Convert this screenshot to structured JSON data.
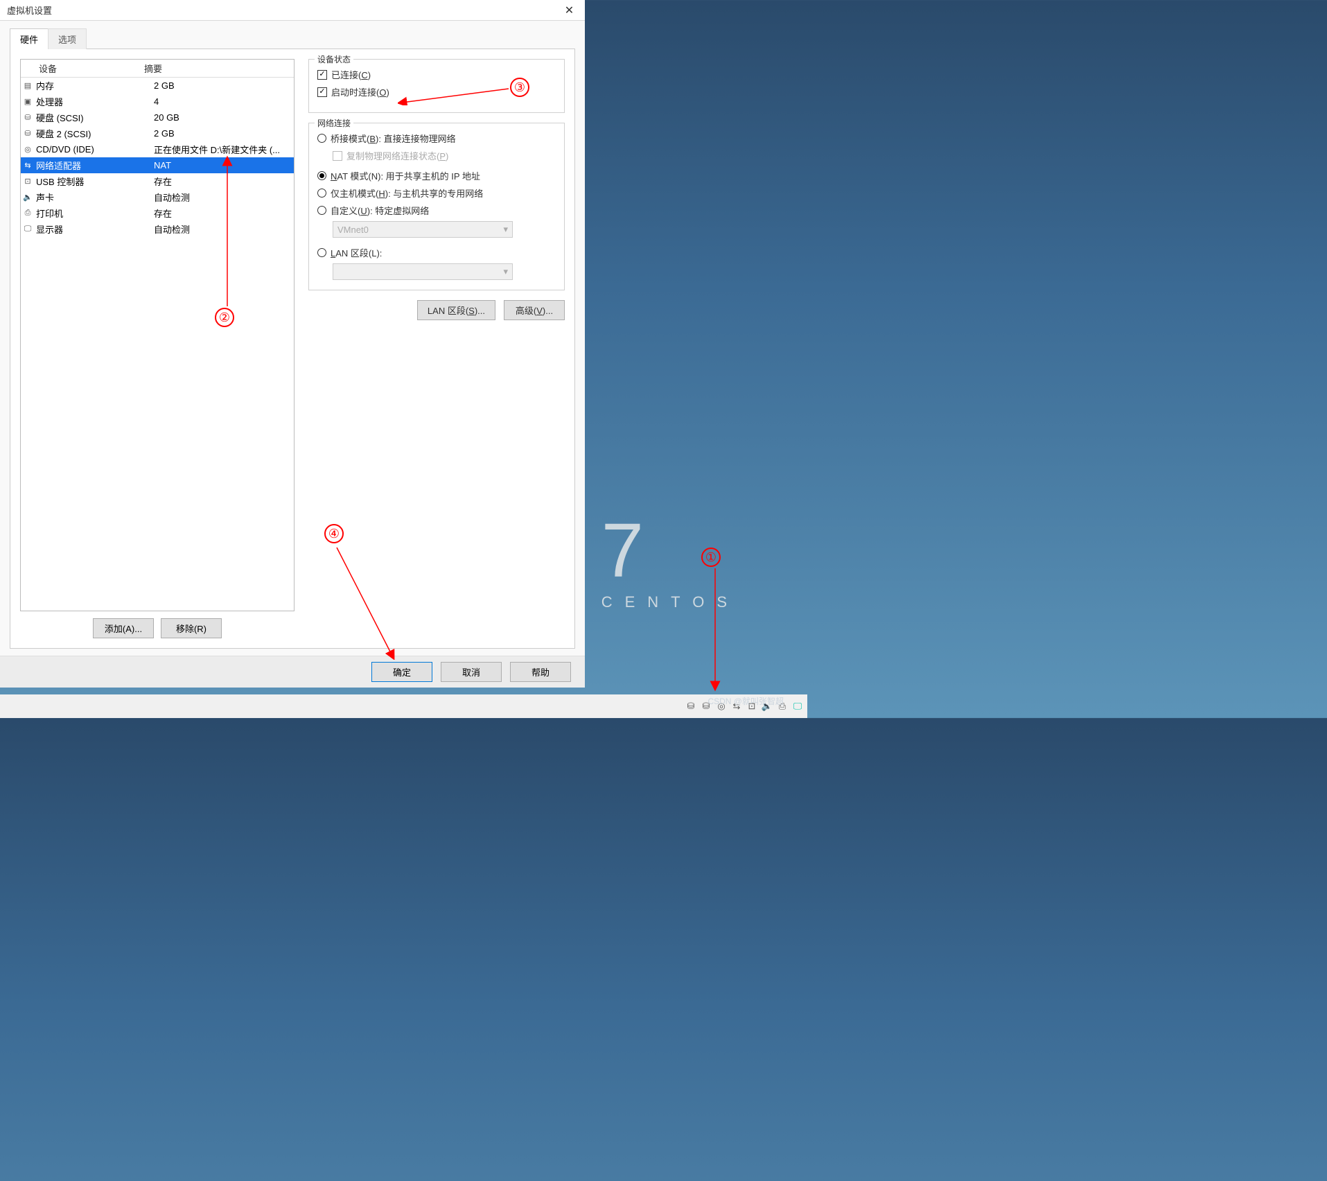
{
  "dialog": {
    "title": "虚拟机设置",
    "tabs": {
      "hardware": "硬件",
      "options": "选项"
    },
    "columns": {
      "device": "设备",
      "summary": "摘要"
    },
    "devices": [
      {
        "icon": "▤",
        "name": "内存",
        "summary": "2 GB"
      },
      {
        "icon": "▣",
        "name": "处理器",
        "summary": "4"
      },
      {
        "icon": "⛁",
        "name": "硬盘 (SCSI)",
        "summary": "20 GB"
      },
      {
        "icon": "⛁",
        "name": "硬盘 2 (SCSI)",
        "summary": "2 GB"
      },
      {
        "icon": "◎",
        "name": "CD/DVD (IDE)",
        "summary": "正在使用文件 D:\\新建文件夹 (..."
      },
      {
        "icon": "⇆",
        "name": "网络适配器",
        "summary": "NAT",
        "selected": true
      },
      {
        "icon": "⊡",
        "name": "USB 控制器",
        "summary": "存在"
      },
      {
        "icon": "🔈",
        "name": "声卡",
        "summary": "自动检测"
      },
      {
        "icon": "⎙",
        "name": "打印机",
        "summary": "存在"
      },
      {
        "icon": "🖵",
        "name": "显示器",
        "summary": "自动检测"
      }
    ],
    "add_btn": "添加(A)...",
    "remove_btn": "移除(R)",
    "status_group": "设备状态",
    "connected": "已连接(C)",
    "connect_at_power": "启动时连接(O)",
    "net_group": "网络连接",
    "bridged": "桥接模式(B): 直接连接物理网络",
    "replicate": "复制物理网络连接状态(P)",
    "nat": "NAT 模式(N): 用于共享主机的 IP 地址",
    "hostonly": "仅主机模式(H): 与主机共享的专用网络",
    "custom": "自定义(U): 特定虚拟网络",
    "vmnet_sel": "VMnet0",
    "lan": "LAN 区段(L):",
    "lan_btn": "LAN 区段(S)...",
    "adv_btn": "高级(V)...",
    "ok": "确定",
    "cancel": "取消",
    "help": "帮助"
  },
  "desktop": {
    "seven": "7",
    "centos": "CENTOS"
  },
  "annotations": {
    "n1": "①",
    "n2": "②",
    "n3": "③",
    "n4": "④"
  },
  "watermark": "CSDN @就叫张智超"
}
